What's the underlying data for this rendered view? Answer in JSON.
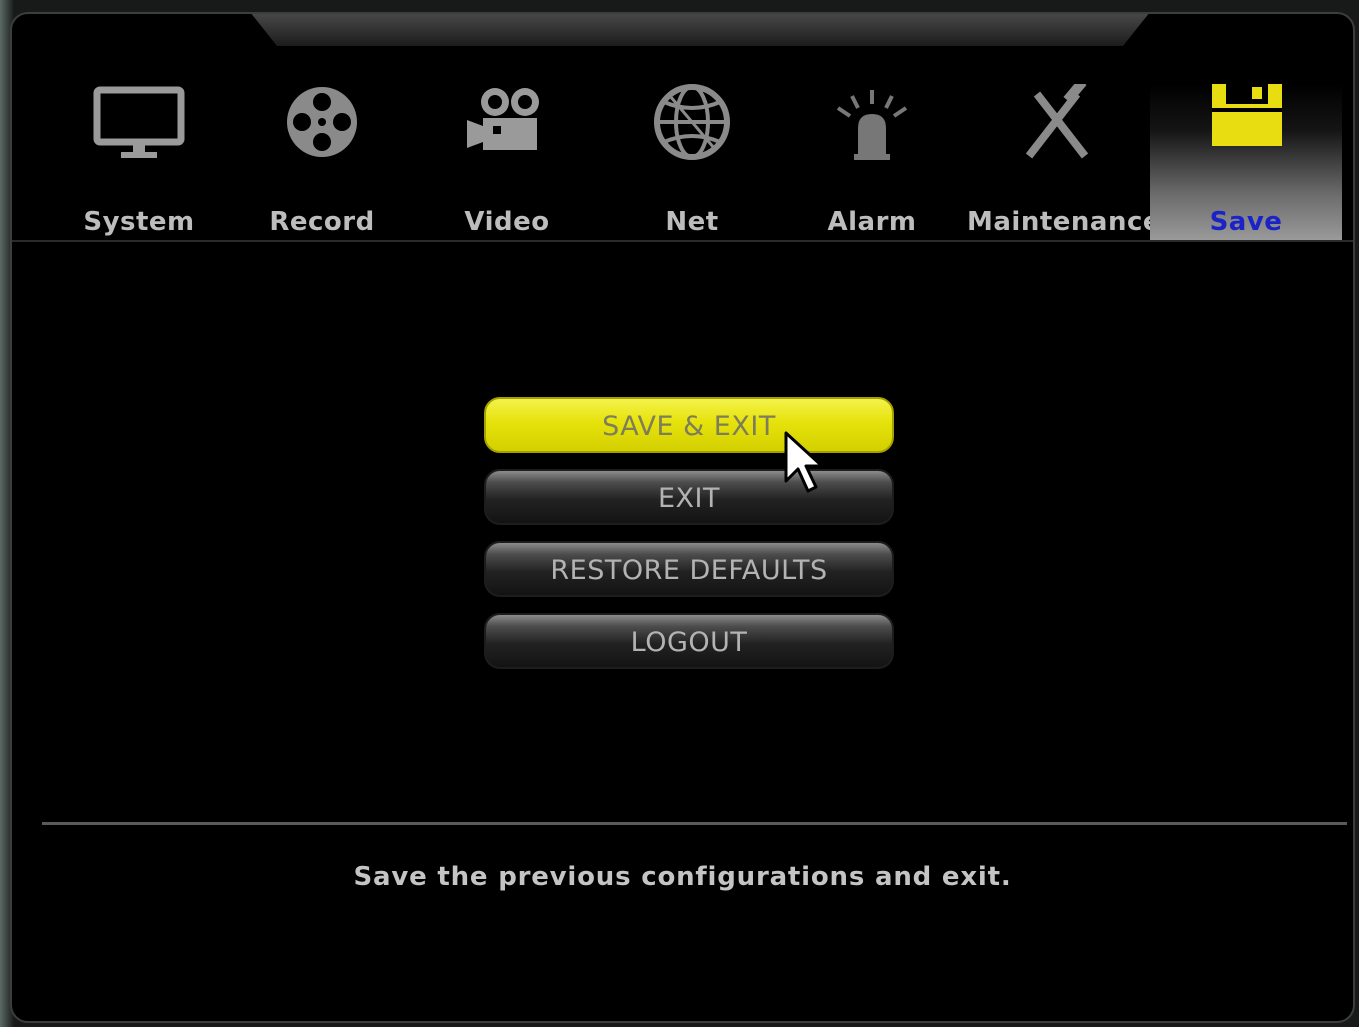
{
  "tabs": [
    {
      "label": "System",
      "icon": "monitor-icon"
    },
    {
      "label": "Record",
      "icon": "film-reel-icon"
    },
    {
      "label": "Video",
      "icon": "video-camera-icon"
    },
    {
      "label": "Net",
      "icon": "globe-icon"
    },
    {
      "label": "Alarm",
      "icon": "alarm-siren-icon"
    },
    {
      "label": "Maintenance",
      "icon": "tools-icon"
    },
    {
      "label": "Save",
      "icon": "floppy-disk-icon",
      "active": true
    }
  ],
  "buttons": {
    "save_exit": "SAVE & EXIT",
    "exit": "EXIT",
    "restore_defaults": "RESTORE DEFAULTS",
    "logout": "LOGOUT"
  },
  "status": {
    "description": "Save the previous configurations and exit."
  },
  "colors": {
    "active_tab_label": "#1a22c8",
    "selected_button": "#e6e20c",
    "background": "#000000"
  }
}
